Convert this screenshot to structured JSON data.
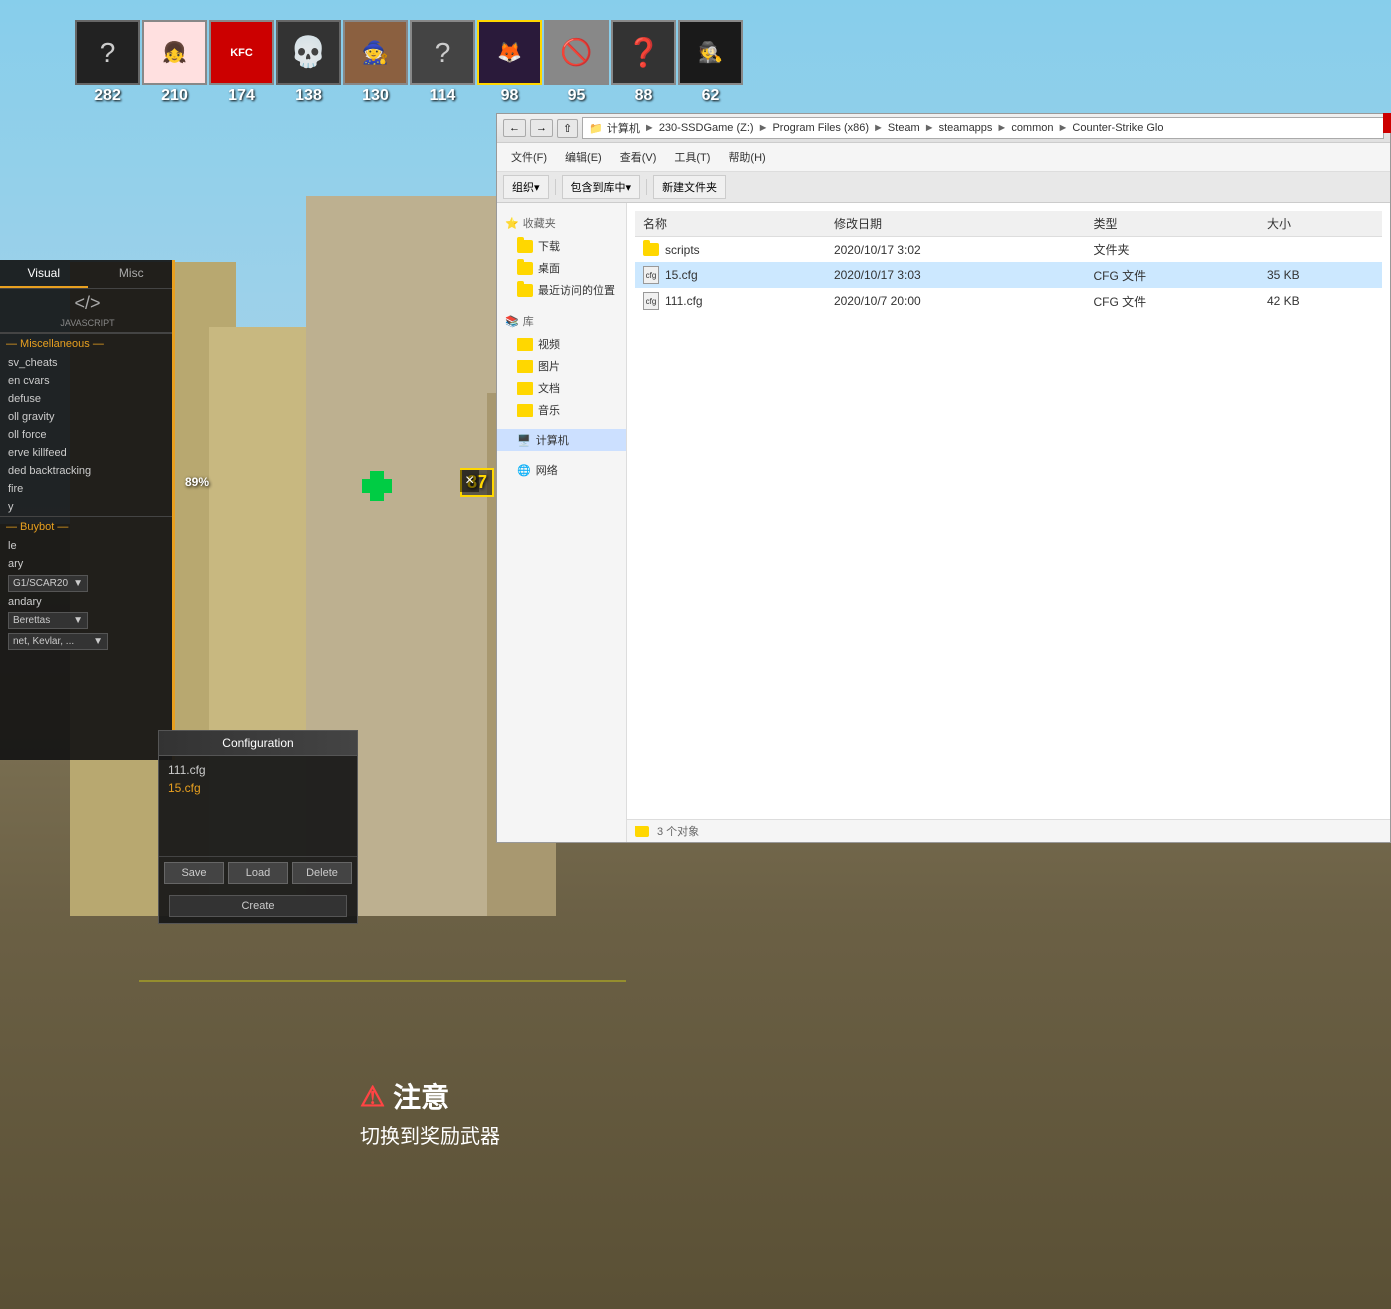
{
  "hud": {
    "players": [
      {
        "id": 1,
        "type": "question",
        "score": "282",
        "highlight": false
      },
      {
        "id": 2,
        "type": "anime-girl",
        "score": "210",
        "highlight": false
      },
      {
        "id": 3,
        "type": "kfc",
        "score": "174",
        "highlight": false
      },
      {
        "id": 4,
        "type": "skull",
        "score": "138",
        "highlight": false
      },
      {
        "id": 5,
        "type": "character",
        "score": "130",
        "highlight": false
      },
      {
        "id": 6,
        "type": "question2",
        "score": "114",
        "highlight": false
      },
      {
        "id": 7,
        "type": "purple-anime",
        "score": "98",
        "highlight": true
      },
      {
        "id": 8,
        "type": "banned",
        "score": "95",
        "highlight": false
      },
      {
        "id": 9,
        "type": "question3",
        "score": "88",
        "highlight": false
      },
      {
        "id": 10,
        "type": "dark-char",
        "score": "62",
        "highlight": false
      }
    ]
  },
  "cheat_panel": {
    "tabs": [
      {
        "label": "Visual",
        "active": true
      },
      {
        "label": "Misc",
        "active": false
      }
    ],
    "code_label": "JAVASCRIPT",
    "sections": [
      {
        "title": "— Miscellaneous —",
        "items": [
          {
            "label": "sv_cheats",
            "type": "toggle"
          },
          {
            "label": "en cvars",
            "type": "toggle"
          },
          {
            "label": "defuse",
            "type": "toggle"
          },
          {
            "label": "oll gravity",
            "type": "toggle"
          },
          {
            "label": "oll force",
            "type": "toggle"
          },
          {
            "label": "erve killfeed",
            "type": "toggle"
          },
          {
            "label": "ded backtracking",
            "type": "toggle"
          },
          {
            "label": "fire",
            "type": "toggle"
          },
          {
            "label": "y",
            "type": "toggle"
          }
        ]
      },
      {
        "title": "— Buybot —",
        "items": [
          {
            "label": "le",
            "type": "toggle"
          },
          {
            "label": "ary",
            "type": "toggle"
          }
        ],
        "dropdowns": [
          {
            "label": "G1/SCAR20",
            "type": "select"
          },
          {
            "label": "andary",
            "type": "select"
          },
          {
            "label": "Berettas",
            "type": "select"
          },
          {
            "label": "net, Kevlar, ...",
            "type": "select"
          }
        ]
      }
    ]
  },
  "config_panel": {
    "title": "Configuration",
    "files": [
      {
        "name": "111.cfg",
        "active": false
      },
      {
        "name": "15.cfg",
        "active": true
      }
    ],
    "buttons": {
      "save": "Save",
      "load": "Load",
      "delete": "Delete",
      "create": "Create"
    }
  },
  "warning": {
    "icon": "⚠",
    "title": "注意",
    "text": "切换到奖励武器"
  },
  "explorer": {
    "title": "Counter-Strike Glo",
    "path_parts": [
      "计算机",
      "230-SSDGame (Z:)",
      "Program Files (x86)",
      "Steam",
      "steamapps",
      "common",
      "Counter-Strike Glo"
    ],
    "menu": [
      "文件(F)",
      "编辑(E)",
      "查看(V)",
      "工具(T)",
      "帮助(H)"
    ],
    "toolbar": [
      "组织▾",
      "包含到库中▾",
      "新建文件夹"
    ],
    "sidebar": {
      "favorites_header": "收藏夹",
      "favorites": [
        {
          "label": "下载",
          "icon": "folder"
        },
        {
          "label": "桌面",
          "icon": "folder"
        },
        {
          "label": "最近访问的位置",
          "icon": "folder"
        }
      ],
      "library_header": "库",
      "libraries": [
        {
          "label": "视频",
          "icon": "library"
        },
        {
          "label": "图片",
          "icon": "library"
        },
        {
          "label": "文档",
          "icon": "library"
        },
        {
          "label": "音乐",
          "icon": "library"
        }
      ],
      "computer_header": "计算机",
      "network_header": "网络"
    },
    "columns": [
      "名称",
      "修改日期",
      "类型",
      "大小"
    ],
    "files": [
      {
        "name": "scripts",
        "date": "2020/10/17 3:02",
        "type": "文件夹",
        "size": "",
        "is_folder": true,
        "selected": false
      },
      {
        "name": "15.cfg",
        "date": "2020/10/17 3:03",
        "type": "CFG 文件",
        "size": "35 KB",
        "is_folder": false,
        "selected": true
      },
      {
        "name": "111.cfg",
        "date": "2020/10/7 20:00",
        "type": "CFG 文件",
        "size": "42 KB",
        "is_folder": false,
        "selected": false
      }
    ],
    "status": "3 个对象"
  },
  "game_overlay": {
    "health_percent": "89%",
    "player_score": "87",
    "close_btn": "×"
  }
}
